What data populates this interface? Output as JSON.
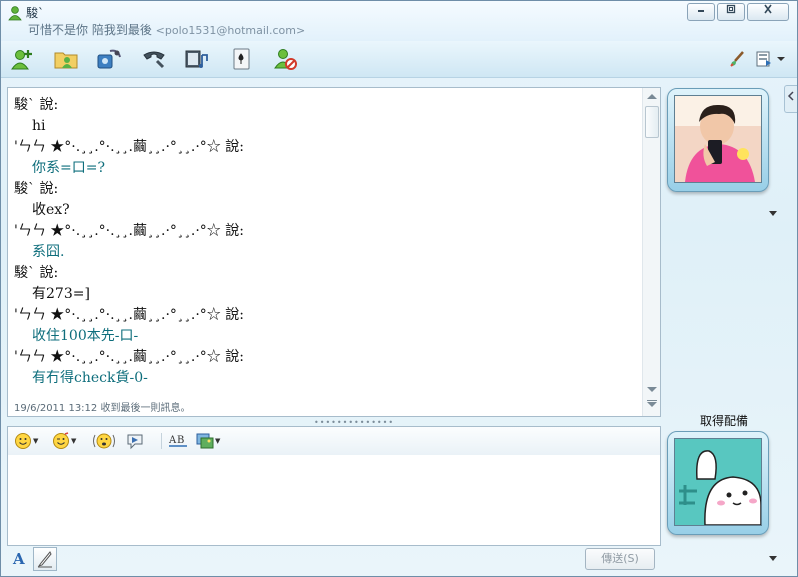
{
  "window": {
    "contact_name": "駿`",
    "personal_message": "可惜不是你 陪我到最後",
    "email": "<polo1531@hotmail.com>",
    "minimize_label": "▭",
    "maximize_label": "▣",
    "close_label": "✕"
  },
  "toolbar": {
    "icons": [
      "invite-contact-icon",
      "share-files-icon",
      "video-call-icon",
      "phone-call-icon",
      "activities-icon",
      "games-icon",
      "block-contact-icon"
    ],
    "right_icons": [
      "paint-brush-icon",
      "layout-menu-icon"
    ]
  },
  "conversation": {
    "messages": [
      {
        "sender": "駿` 說:",
        "text": "hi",
        "style": "black"
      },
      {
        "sender": "'ㄣㄣ          ★°·.¸¸.°·.¸¸.繭¸¸.·°¸¸.·°☆ 說:",
        "text": "你系=口=?",
        "style": "blue"
      },
      {
        "sender": "駿` 說:",
        "text": "收ex?",
        "style": "black"
      },
      {
        "sender": "'ㄣㄣ          ★°·.¸¸.°·.¸¸.繭¸¸.·°¸¸.·°☆ 說:",
        "text": "系囧.",
        "style": "blue"
      },
      {
        "sender": "駿` 說:",
        "text": "有273=]",
        "style": "black"
      },
      {
        "sender": "'ㄣㄣ          ★°·.¸¸.°·.¸¸.繭¸¸.·°¸¸.·°☆ 說:",
        "text": "收住100本先-口-",
        "style": "blue"
      },
      {
        "sender": "'ㄣㄣ          ★°·.¸¸.°·.¸¸.繭¸¸.·°¸¸.·°☆ 說:",
        "text": "有冇得check貨-0-",
        "style": "blue"
      }
    ],
    "status": "19/6/2011 13:12 收到最後一則訊息。"
  },
  "compose": {
    "send_label": "傳送(S)",
    "font_label": "A"
  },
  "sidebar": {
    "get_device_label": "取得配備"
  },
  "colors": {
    "accent": "#0e6e7c",
    "frame": "#98cfe7"
  }
}
